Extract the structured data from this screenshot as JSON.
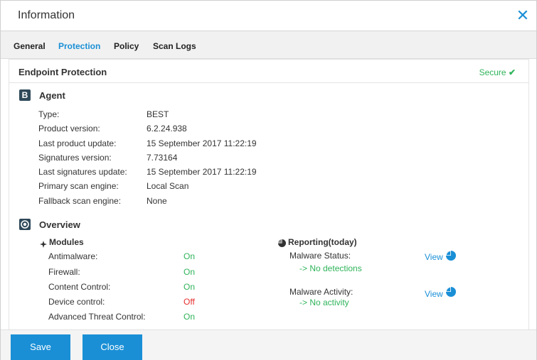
{
  "window": {
    "title": "Information",
    "close_label": "✕"
  },
  "tabs": [
    "General",
    "Protection",
    "Policy",
    "Scan Logs"
  ],
  "section": {
    "title": "Endpoint Protection",
    "status": "Secure",
    "status_icon": "✔"
  },
  "agent": {
    "heading": "Agent",
    "badge": "B",
    "rows": [
      {
        "label": "Type:",
        "value": "BEST"
      },
      {
        "label": "Product version:",
        "value": "6.2.24.938"
      },
      {
        "label": "Last product update:",
        "value": "15 September 2017 11:22:19"
      },
      {
        "label": "Signatures version:",
        "value": "7.73164"
      },
      {
        "label": "Last signatures update:",
        "value": "15 September 2017 11:22:19"
      },
      {
        "label": "Primary scan engine:",
        "value": "Local Scan"
      },
      {
        "label": "Fallback scan engine:",
        "value": "None"
      }
    ]
  },
  "overview": {
    "heading": "Overview",
    "modules": {
      "heading": "Modules",
      "items": [
        {
          "label": "Antimalware:",
          "value": "On",
          "color": "#2fb45a"
        },
        {
          "label": "Firewall:",
          "value": "On",
          "color": "#2fb45a"
        },
        {
          "label": "Content Control:",
          "value": "On",
          "color": "#2fb45a"
        },
        {
          "label": "Device control:",
          "value": "Off",
          "color": "#e52f2f"
        },
        {
          "label": "Advanced Threat Control:",
          "value": "On",
          "color": "#2fb45a"
        }
      ]
    },
    "reporting": {
      "heading": "Reporting(today)",
      "items": [
        {
          "label": "Malware Status:",
          "detail": "-> No detections",
          "link": "View"
        },
        {
          "label": "Malware Activity:",
          "detail": "-> No activity",
          "link": "View"
        }
      ]
    }
  },
  "footer": {
    "save": "Save",
    "close": "Close"
  },
  "colors": {
    "accent": "#1a8fd6",
    "ok": "#2fb45a",
    "off": "#e52f2f",
    "badge": "#2f4959"
  }
}
